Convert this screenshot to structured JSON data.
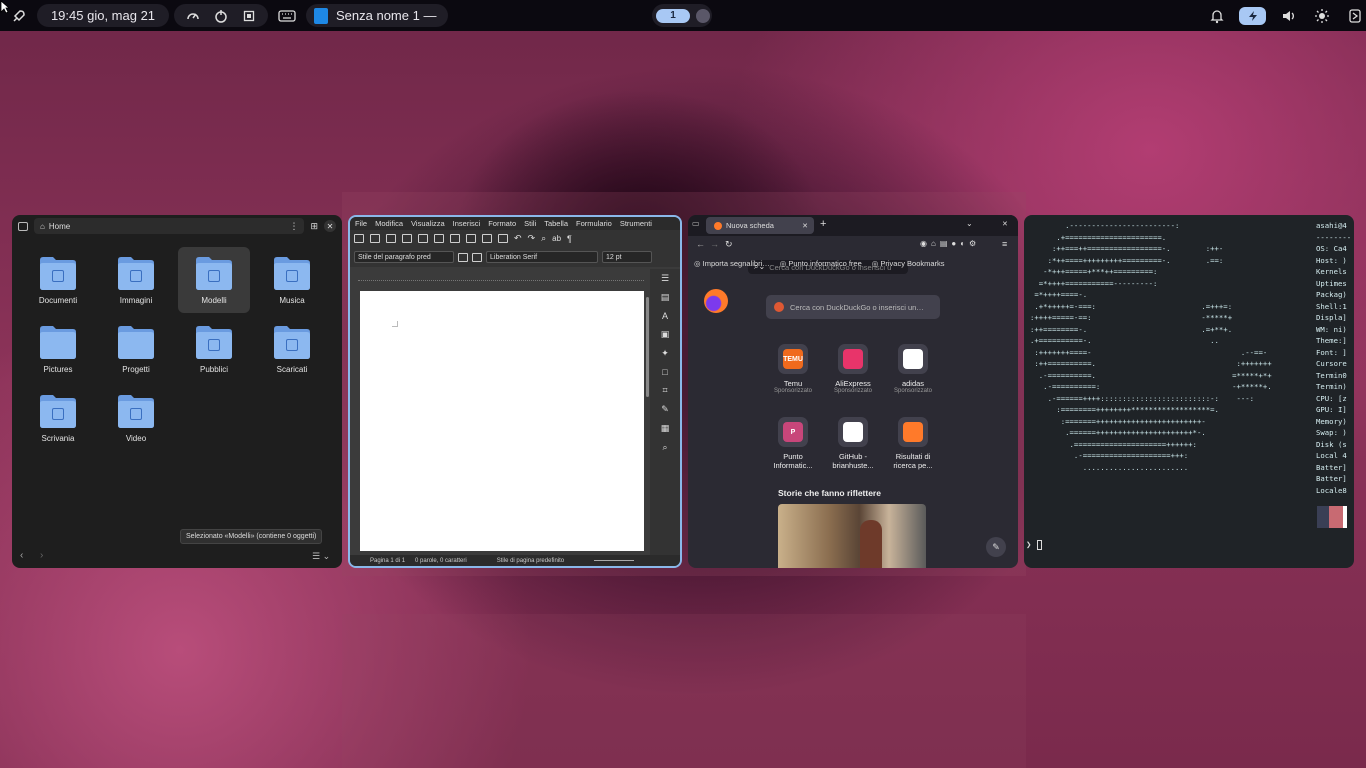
{
  "topbar": {
    "datetime": "19:45 gio, mag 21",
    "window_title": "Senza nome 1 —",
    "workspace_active": "1"
  },
  "files": {
    "location": "Home",
    "folders": [
      {
        "name": "Documenti",
        "icon": "document-icon"
      },
      {
        "name": "Immagini",
        "icon": "image-icon"
      },
      {
        "name": "Modelli",
        "icon": "template-icon"
      },
      {
        "name": "Musica",
        "icon": "music-icon"
      },
      {
        "name": "Pictures",
        "icon": "none"
      },
      {
        "name": "Progetti",
        "icon": "none"
      },
      {
        "name": "Pubblici",
        "icon": "share-icon"
      },
      {
        "name": "Scaricati",
        "icon": "download-icon"
      },
      {
        "name": "Scrivania",
        "icon": "desktop-folder-icon"
      },
      {
        "name": "Video",
        "icon": "video-icon"
      }
    ],
    "selected": "Modelli",
    "status": "Selezionato «Modelli» (contiene 0 oggetti)",
    "accent": "#8cb8f0"
  },
  "writer": {
    "menu": [
      "File",
      "Modifica",
      "Visualizza",
      "Inserisci",
      "Formato",
      "Stili",
      "Tabella",
      "Formulario",
      "Strumenti"
    ],
    "paragraph_style": "Stile del paragrafo pred",
    "font": "Liberation Serif",
    "font_size": "12 pt",
    "status_page": "Pagina 1 di 1",
    "status_words": "0 parole, 0 caratteri",
    "status_style": "Stile di pagina predefinito"
  },
  "firefox": {
    "tab_title": "Nuova scheda",
    "url_placeholder": "Cerca con DuckDuckGo o inserisci u",
    "bookmarks": [
      "Importa segnalibri…",
      "Punto informatico free",
      "Privacy Bookmarks"
    ],
    "search_placeholder": "Cerca con DuckDuckGo o inserisci un…",
    "shortcuts_row1": [
      {
        "name": "Temu",
        "sub": "Sponsorizzato",
        "badge": "TEMU",
        "color": "#f06a1d"
      },
      {
        "name": "AliExpress",
        "sub": "Sponsorizzato",
        "badge": "",
        "color": "#e8346a"
      },
      {
        "name": "adidas",
        "sub": "Sponsorizzato",
        "badge": "",
        "color": "#ffffff"
      }
    ],
    "shortcuts_row2": [
      {
        "name": "Punto Informatic...",
        "badge": "P",
        "color": "#c8467a"
      },
      {
        "name": "GitHub - brianhuste...",
        "badge": "",
        "color": "#ffffff"
      },
      {
        "name": "Risultati di ricerca pe...",
        "badge": "",
        "color": "#ff7a2a"
      }
    ],
    "stories_title": "Storie che fanno riflettere"
  },
  "terminal": {
    "ascii": [
      "        .------------------------:",
      "      .+======================.",
      "     :++===++=================-.        :++-",
      "    :*++====+++++++++=========-.        .==:",
      "   -*+++=====+***++=========:",
      "  =*++++===========---------:",
      " =*++++====-.",
      " .+*+++++=-===:                        .=+++=:",
      ":++++=====-==:                         -*****+",
      ":++========-.                          .=+**+.",
      ".+==========-.                           ..",
      " :+++++++====-                                  .--==-",
      " :++==========.                                :+++++++",
      "  .-==========.                               =*****+*+",
      "   .-==========:                              -+*****+.",
      "    .-======++++:::::::::::::::::::::::::-:    ---:",
      "      :========++++++++******************=.",
      "       :=======++++++++++++++++++++++++-",
      "        .======++++++++++++++++++++++*-.",
      "         .=====================++++++:",
      "          .-====================+++:",
      "            ........................"
    ],
    "info": [
      "asahi@4",
      "--------",
      "OS: Ca4",
      "Host: )",
      "Kernels",
      "Uptimes",
      "Packag)",
      "Shell:1",
      "Displa]",
      "WM: ni)",
      "Theme:]",
      "Font: ]",
      "Cursore",
      "Termin0",
      "Termin)",
      "CPU: [z",
      "GPU: I]",
      "Memory)",
      "Swap: )",
      "Disk (s",
      "Local 4",
      "Batter]",
      "Batter]",
      "Locale8"
    ],
    "prompt": "❯ "
  }
}
